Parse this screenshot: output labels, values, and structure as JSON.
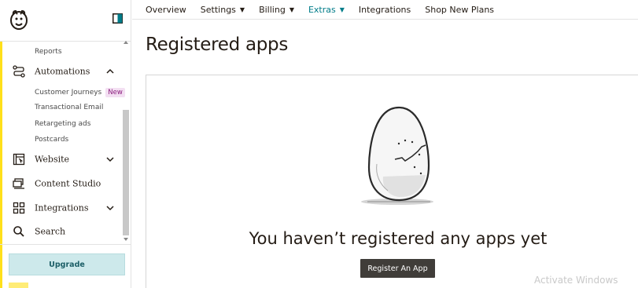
{
  "sidebar": {
    "reports_label": "Reports",
    "automations_label": "Automations",
    "automations_sub": [
      {
        "label": "Customer Journeys",
        "badge": "New"
      },
      {
        "label": "Transactional Email"
      },
      {
        "label": "Retargeting ads"
      },
      {
        "label": "Postcards"
      }
    ],
    "website_label": "Website",
    "content_studio_label": "Content Studio",
    "integrations_label": "Integrations",
    "search_label": "Search",
    "upgrade_label": "Upgrade"
  },
  "topnav": {
    "tabs": [
      {
        "label": "Overview",
        "dropdown": false,
        "active": false
      },
      {
        "label": "Settings",
        "dropdown": true,
        "active": false
      },
      {
        "label": "Billing",
        "dropdown": true,
        "active": false
      },
      {
        "label": "Extras",
        "dropdown": true,
        "active": true
      },
      {
        "label": "Integrations",
        "dropdown": false,
        "active": false
      },
      {
        "label": "Shop New Plans",
        "dropdown": false,
        "active": false
      }
    ]
  },
  "page": {
    "title": "Registered apps",
    "empty_state_title": "You haven’t registered any apps yet",
    "register_button": "Register An App"
  },
  "watermark": "Activate Windows",
  "colors": {
    "accent_yellow": "#ffe01b",
    "active_tab": "#007c89",
    "upgrade_bg": "#cde9eb",
    "primary_button": "#403d39"
  }
}
